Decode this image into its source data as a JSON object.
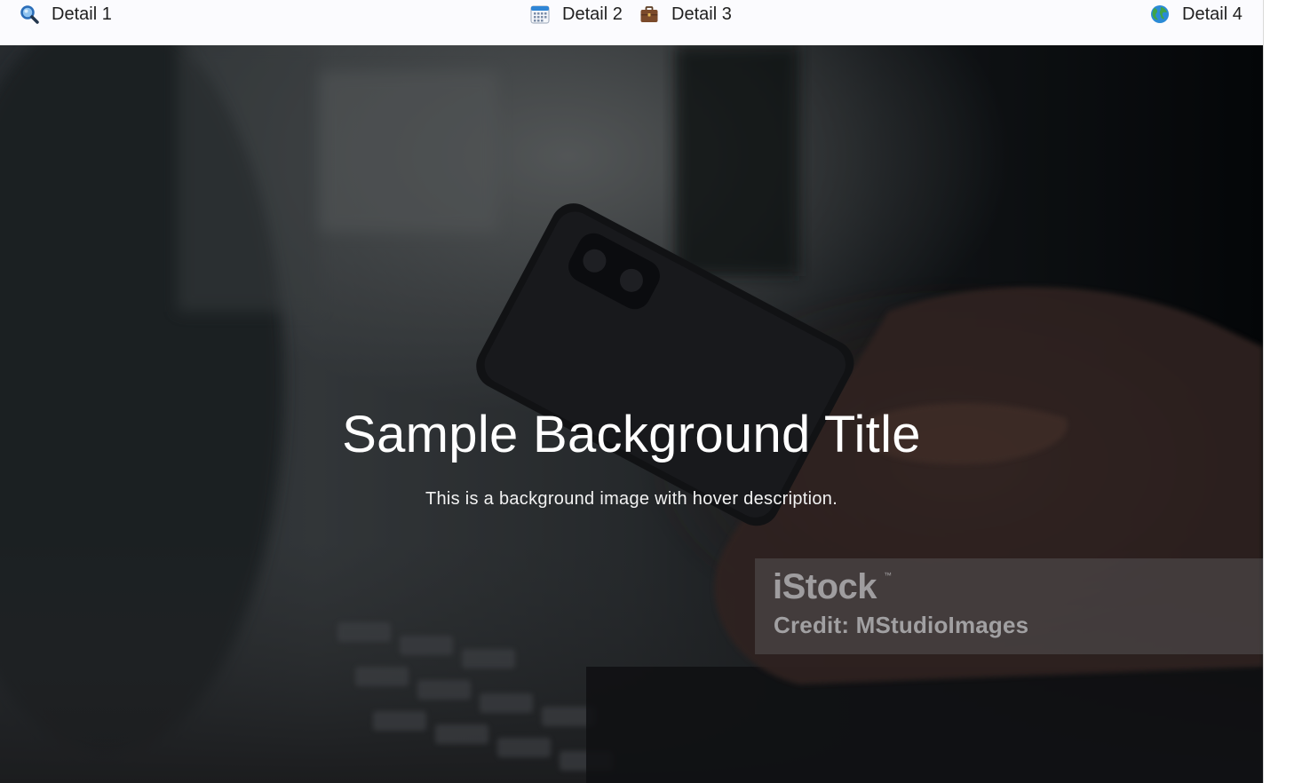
{
  "topbar": {
    "items": [
      {
        "label": "Detail 1",
        "icon": "magnifier-icon"
      },
      {
        "label": "Detail 2",
        "icon": "calendar-icon"
      },
      {
        "label": "Detail 3",
        "icon": "briefcase-icon"
      },
      {
        "label": "Detail 4",
        "icon": "globe-icon"
      }
    ]
  },
  "hero": {
    "title": "Sample Background Title",
    "description": "This is a background image with hover description.",
    "watermark": {
      "logo": "iStock",
      "trademark": "™",
      "credit": "Credit: MStudioImages"
    }
  },
  "colors": {
    "topbar_bg": "#fbfbfe",
    "hero_overlay": "#2b2e31",
    "title_text": "#ffffff"
  }
}
